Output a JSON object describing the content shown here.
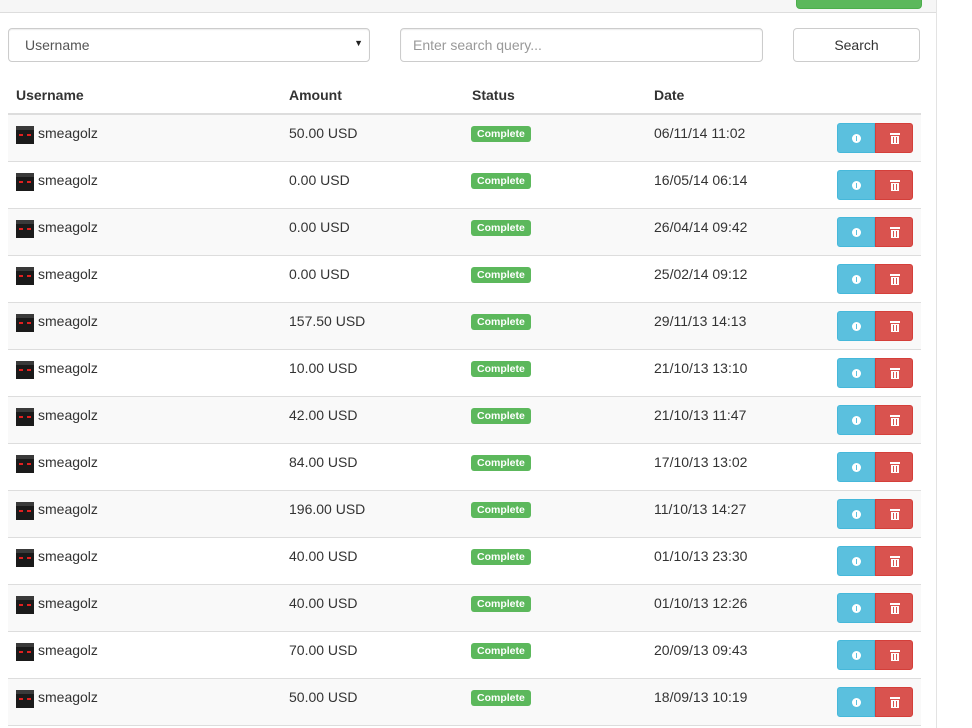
{
  "filters": {
    "username_select_value": "Username",
    "search_placeholder": "Enter search query...",
    "search_button_label": "Search"
  },
  "table": {
    "headers": {
      "username": "Username",
      "amount": "Amount",
      "status": "Status",
      "date": "Date"
    },
    "rows": [
      {
        "username": "smeagolz",
        "amount": "50.00 USD",
        "status": "Complete",
        "date": "06/11/14 11:02"
      },
      {
        "username": "smeagolz",
        "amount": "0.00 USD",
        "status": "Complete",
        "date": "16/05/14 06:14"
      },
      {
        "username": "smeagolz",
        "amount": "0.00 USD",
        "status": "Complete",
        "date": "26/04/14 09:42"
      },
      {
        "username": "smeagolz",
        "amount": "0.00 USD",
        "status": "Complete",
        "date": "25/02/14 09:12"
      },
      {
        "username": "smeagolz",
        "amount": "157.50 USD",
        "status": "Complete",
        "date": "29/11/13 14:13"
      },
      {
        "username": "smeagolz",
        "amount": "10.00 USD",
        "status": "Complete",
        "date": "21/10/13 13:10"
      },
      {
        "username": "smeagolz",
        "amount": "42.00 USD",
        "status": "Complete",
        "date": "21/10/13 11:47"
      },
      {
        "username": "smeagolz",
        "amount": "84.00 USD",
        "status": "Complete",
        "date": "17/10/13 13:02"
      },
      {
        "username": "smeagolz",
        "amount": "196.00 USD",
        "status": "Complete",
        "date": "11/10/13 14:27"
      },
      {
        "username": "smeagolz",
        "amount": "40.00 USD",
        "status": "Complete",
        "date": "01/10/13 23:30"
      },
      {
        "username": "smeagolz",
        "amount": "40.00 USD",
        "status": "Complete",
        "date": "01/10/13 12:26"
      },
      {
        "username": "smeagolz",
        "amount": "70.00 USD",
        "status": "Complete",
        "date": "20/09/13 09:43"
      },
      {
        "username": "smeagolz",
        "amount": "50.00 USD",
        "status": "Complete",
        "date": "18/09/13 10:19"
      }
    ],
    "row_actions": {
      "info_icon": "info-icon",
      "delete_icon": "trash-icon"
    }
  },
  "colors": {
    "status_complete": "#5cb85c",
    "info_button": "#5bc0de",
    "danger_button": "#d9534f"
  }
}
